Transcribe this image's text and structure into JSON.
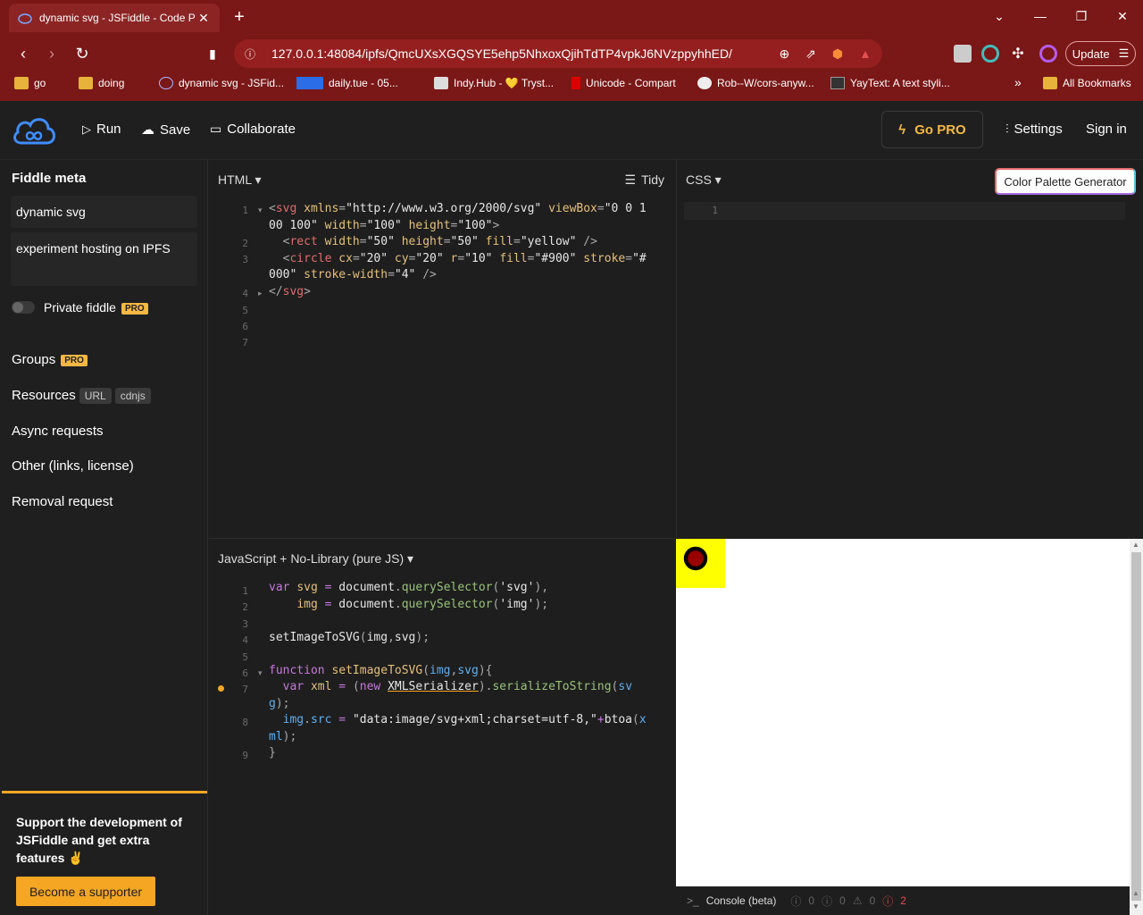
{
  "browser": {
    "tab_title": "dynamic svg - JSFiddle - Code P",
    "tab_close": "✕",
    "new_tab": "+",
    "url": "127.0.0.1:48084/ipfs/QmcUXsXGQSYE5ehp5NhxoxQjihTdTP4vpkJ6NVzppyhhED/",
    "update_label": "Update",
    "bookmarks": [
      {
        "label": "go",
        "icon": "folder-icon"
      },
      {
        "label": "doing",
        "icon": "folder-icon"
      },
      {
        "label": "dynamic svg - JSFid...",
        "icon": "jsfiddle-icon"
      },
      {
        "label": "daily.tue - 05...",
        "icon": "calendar-icon"
      },
      {
        "label": "Indy.Hub - 💛 Tryst...",
        "icon": "indyhub-icon"
      },
      {
        "label": "Unicode - Compart",
        "icon": "compart-icon"
      },
      {
        "label": "Rob--W/cors-anyw...",
        "icon": "github-icon"
      },
      {
        "label": "YayText: A text styli...",
        "icon": "yaytext-icon"
      }
    ],
    "overflow": "»",
    "all_bookmarks": "All Bookmarks"
  },
  "app": {
    "run_label": "Run",
    "save_label": "Save",
    "collaborate_label": "Collaborate",
    "gopro_label": "Go PRO",
    "settings_label": "Settings",
    "signin_label": "Sign in"
  },
  "sidebar": {
    "title": "Fiddle meta",
    "fiddle_title": "dynamic svg",
    "fiddle_description": "experiment hosting on IPFS",
    "private_label": "Private fiddle",
    "pro_badge": "PRO",
    "groups_label": "Groups",
    "resources_label": "Resources",
    "url_badge": "URL",
    "cdnjs_badge": "cdnjs",
    "async_label": "Async requests",
    "other_label": "Other (links, license)",
    "removal_label": "Removal request",
    "support_text": "Support the development of JSFiddle and get extra features ✌",
    "support_button": "Become a supporter"
  },
  "html_panel": {
    "title": "HTML ▾",
    "tidy_label": "Tidy",
    "line_numbers": [
      "1",
      "2",
      "3",
      "4",
      "5",
      "6",
      "7"
    ]
  },
  "css_panel": {
    "title": "CSS ▾",
    "palette_label": "Color Palette Generator",
    "line_numbers": [
      "1"
    ]
  },
  "js_panel": {
    "title": "JavaScript + No-Library (pure JS) ▾",
    "line_numbers": [
      "1",
      "2",
      "3",
      "4",
      "5",
      "6",
      "7",
      "8",
      "9"
    ]
  },
  "console": {
    "label": "Console (beta)",
    "counts": [
      "0",
      "0",
      "0",
      "2"
    ]
  },
  "colors": {
    "accent": "#f5a623",
    "browser_red": "#7a1717",
    "preview_yellow": "#ffff00",
    "preview_circle": "#990000"
  }
}
